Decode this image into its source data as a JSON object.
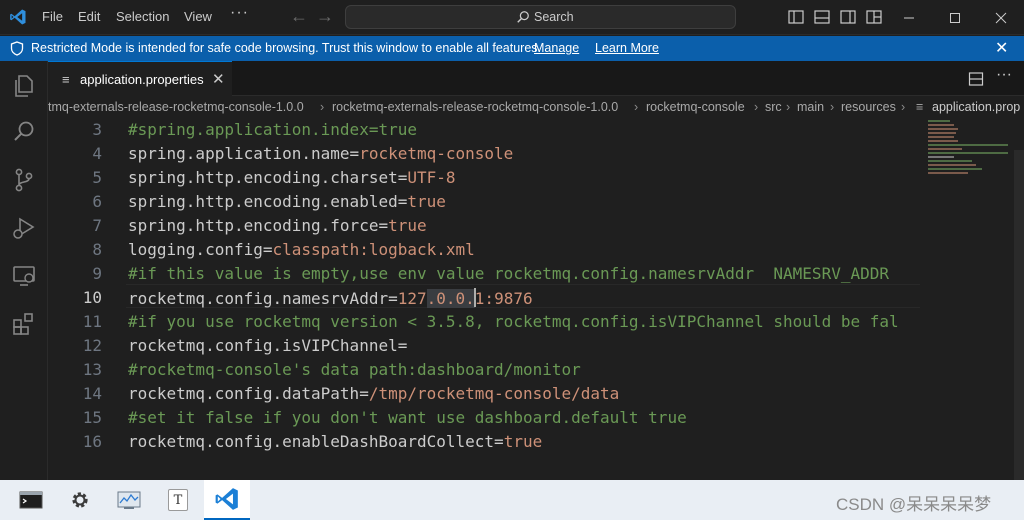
{
  "titlebar": {
    "menu": [
      {
        "label": "File"
      },
      {
        "label": "Edit"
      },
      {
        "label": "Selection"
      },
      {
        "label": "View"
      }
    ],
    "more": "···",
    "search_label": "Search"
  },
  "banner": {
    "message": "Restricted Mode is intended for safe code browsing. Trust this window to enable all features.",
    "manage": "Manage",
    "learn_more": "Learn More",
    "close": "✕"
  },
  "tabs": [
    {
      "label": "application.properties",
      "close": "✕"
    }
  ],
  "breadcrumb": [
    "tmq-externals-release-rocketmq-console-1.0.0",
    "rocketmq-externals-release-rocketmq-console-1.0.0",
    "rocketmq-console",
    "src",
    "main",
    "resources",
    "application.prop"
  ],
  "editor": {
    "active_line": 10,
    "lines": [
      {
        "num": "3",
        "type": "comment",
        "text": "#spring.application.index=true"
      },
      {
        "num": "4",
        "type": "kv",
        "key": "spring.application.name=",
        "value": "rocketmq-console"
      },
      {
        "num": "5",
        "type": "kv",
        "key": "spring.http.encoding.charset=",
        "value": "UTF-8"
      },
      {
        "num": "6",
        "type": "kv",
        "key": "spring.http.encoding.enabled=",
        "value": "true"
      },
      {
        "num": "7",
        "type": "kv",
        "key": "spring.http.encoding.force=",
        "value": "true"
      },
      {
        "num": "8",
        "type": "kv",
        "key": "logging.config=",
        "value": "classpath:logback.xml"
      },
      {
        "num": "9",
        "type": "comment",
        "text": "#if this value is empty,use env value rocketmq.config.namesrvAddr  NAMESRV_ADDR"
      },
      {
        "num": "10",
        "type": "kv",
        "key": "rocketmq.config.namesrvAddr=",
        "value_a": "127",
        "value_sel": ".0.0.",
        "value_b": "1:9876"
      },
      {
        "num": "11",
        "type": "comment",
        "text": "#if you use rocketmq version < 3.5.8, rocketmq.config.isVIPChannel should be fal"
      },
      {
        "num": "12",
        "type": "kv",
        "key": "rocketmq.config.isVIPChannel=",
        "value": ""
      },
      {
        "num": "13",
        "type": "comment",
        "text": "#rocketmq-console's data path:dashboard/monitor"
      },
      {
        "num": "14",
        "type": "kv",
        "key": "rocketmq.config.dataPath=",
        "value": "/tmp/rocketmq-console/data"
      },
      {
        "num": "15",
        "type": "comment",
        "text": "#set it false if you don't want use dashboard.default true"
      },
      {
        "num": "16",
        "type": "kv",
        "key": "rocketmq.config.enableDashBoardCollect=",
        "value": "true"
      }
    ]
  },
  "taskbar": {
    "items": [
      "terminal-app",
      "settings-app",
      "task-manager-app",
      "notepad-app",
      "vscode-app"
    ],
    "notepad_glyph": "T",
    "watermark": "CSDN @呆呆呆呆梦"
  },
  "colors": {
    "accent": "#0078d4",
    "banner_bg": "#0b5fab",
    "comment": "#6a9955",
    "string_value": "#ce9178"
  }
}
